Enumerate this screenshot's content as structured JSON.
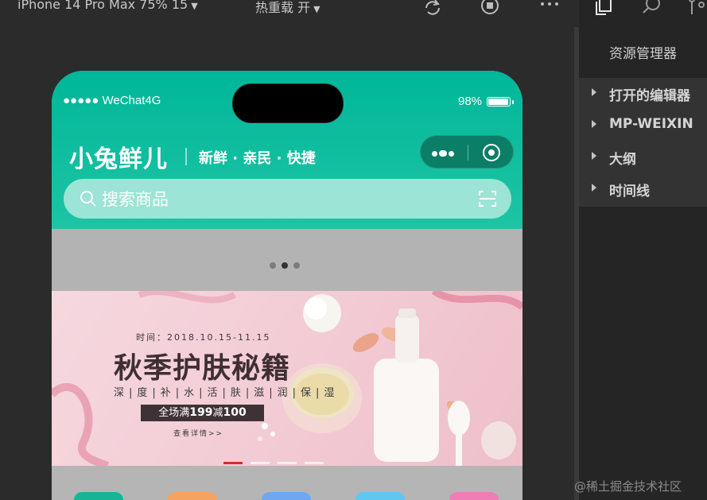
{
  "toolbar": {
    "device": "iPhone 14 Pro Max 75% 15",
    "reload_mode": "热重载 开"
  },
  "phone": {
    "status": {
      "carrier": "●●●●● WeChat4G",
      "battery": "98%",
      "battery_level": 0.98
    },
    "header": {
      "logo": "小兔鲜儿",
      "slogan": "新鲜 · 亲民 · 快捷"
    },
    "search": {
      "placeholder": "搜索商品"
    },
    "banner": {
      "date": "时间：2018.10.15-11.15",
      "title": "秋季护肤秘籍",
      "subtitle": "深|度|补|水|活|肤|滋|润|保|湿",
      "offer_prefix": "全场满",
      "offer_a": "199",
      "offer_mid": "减",
      "offer_b": "100",
      "more": "查看详情>>"
    },
    "categories_colors": [
      "#15b596",
      "#f4a460",
      "#6fa8f0",
      "#5fc7f0",
      "#f07db5"
    ]
  },
  "panel": {
    "title": "资源管理器",
    "sections": [
      "打开的编辑器",
      "MP-WEIXIN",
      "大纲",
      "时间线"
    ]
  },
  "watermark": "@稀土掘金技术社区"
}
